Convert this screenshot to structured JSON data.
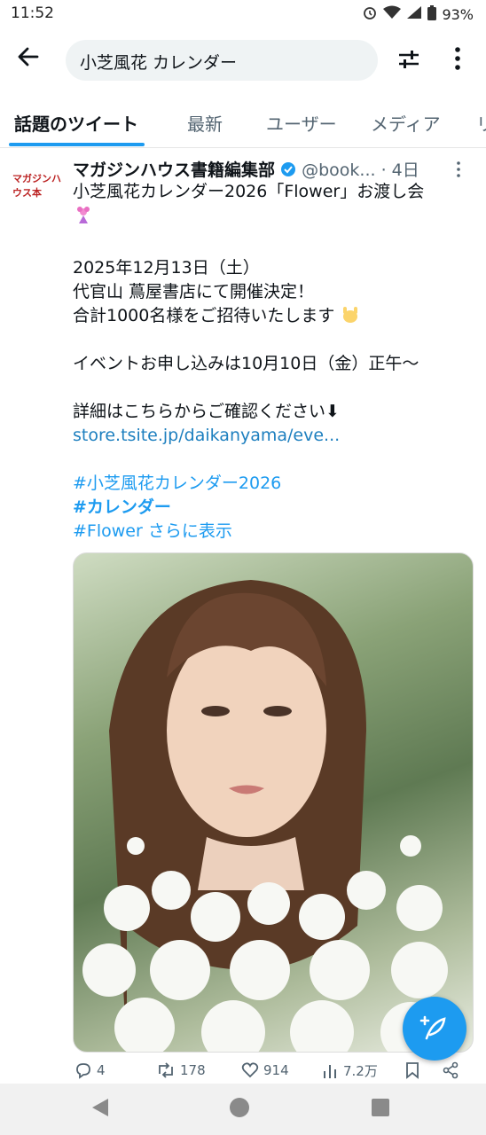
{
  "status": {
    "time": "11:52",
    "battery": "93%"
  },
  "search": {
    "query": "小芝風花 カレンダー"
  },
  "tabs": [
    {
      "label": "話題のツイート"
    },
    {
      "label": "最新"
    },
    {
      "label": "ユーザー"
    },
    {
      "label": "メディア"
    },
    {
      "label": "リ"
    }
  ],
  "tweet": {
    "avatar_text": "マガジンハウス本",
    "name": "マガジンハウス書籍編集部",
    "handle": "@book...",
    "time": "· 4日",
    "title": "小芝風花カレンダー2026「Flower」お渡し会",
    "date_line": "2025年12月13日（土）",
    "venue_line": "代官山 蔦屋書店にて開催決定！",
    "invite_line": "合計1000名様をご招待いたします",
    "apply_line": "イベントお申し込みは10月10日（金）正午〜",
    "detail_line": "詳細はこちらからご確認ください⬇",
    "link": "store.tsite.jp/daikanyama/eve...",
    "hashtag1": "#小芝風花カレンダー2026",
    "hashtag2": "#カレンダー",
    "hashtag3": "#Flower",
    "show_more": "さらに表示",
    "stats": {
      "replies": "4",
      "retweets": "178",
      "likes": "914",
      "views": "7.2万"
    }
  },
  "colors": {
    "accent": "#1d9bf0",
    "link": "#1d7fbf"
  }
}
